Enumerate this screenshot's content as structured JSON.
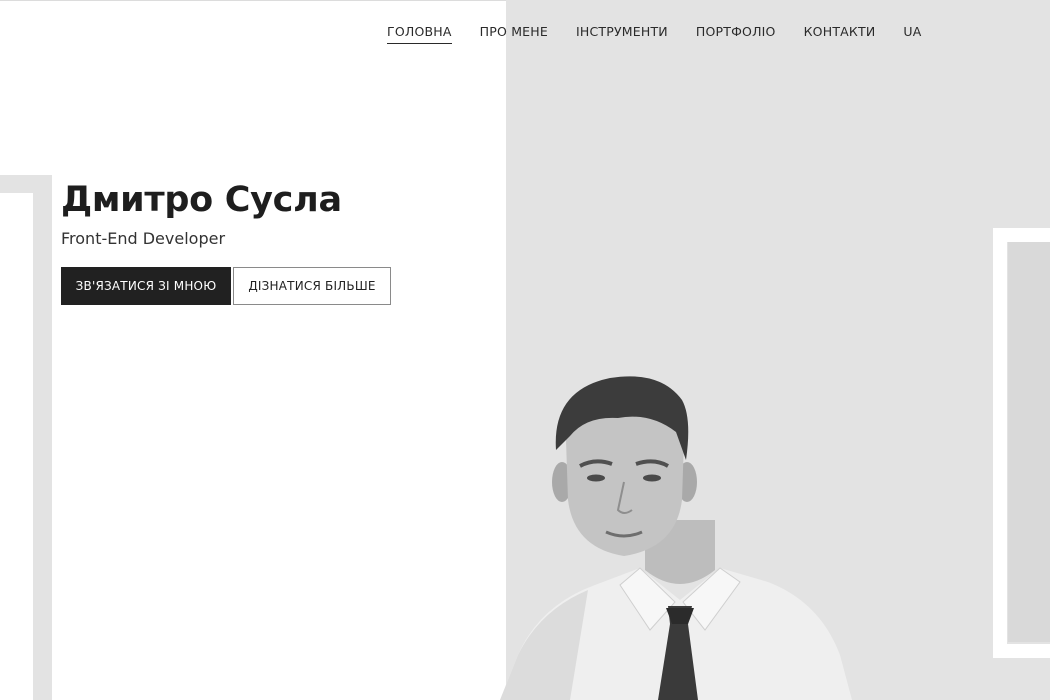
{
  "nav": {
    "items": [
      {
        "label": "ГОЛОВНА",
        "active": true
      },
      {
        "label": "ПРО МЕНЕ",
        "active": false
      },
      {
        "label": "ІНСТРУМЕНТИ",
        "active": false
      },
      {
        "label": "ПОРТФОЛІО",
        "active": false
      },
      {
        "label": "КОНТАКТИ",
        "active": false
      },
      {
        "label": "UA",
        "active": false
      }
    ]
  },
  "hero": {
    "name": "Дмитро Сусла",
    "role": "Front-End Developer",
    "primary_button": "ЗВ'ЯЗАТИСЯ ЗІ МНОЮ",
    "secondary_button": "ДІЗНАТИСЯ БІЛЬШЕ"
  },
  "portrait": {
    "icon": "person-photo"
  },
  "colors": {
    "panel_gray": "#e3e3e3",
    "dark_button": "#212121",
    "text": "#1e1e1e"
  }
}
